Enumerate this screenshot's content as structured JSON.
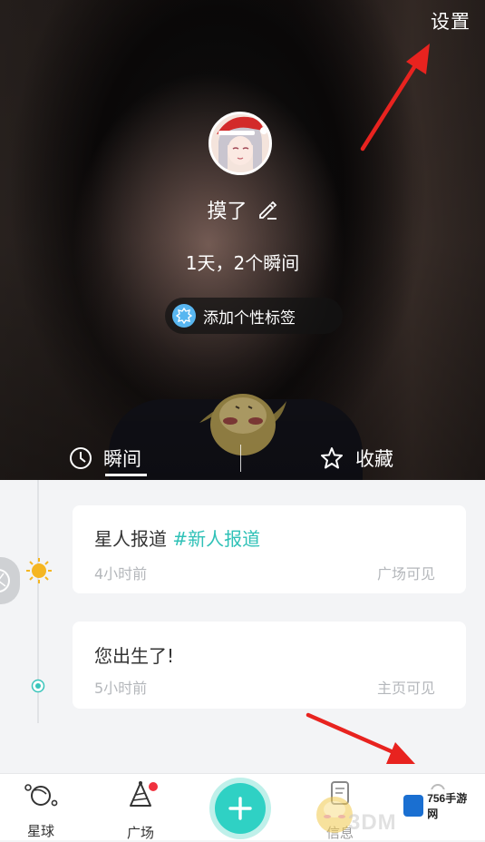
{
  "header": {
    "settings_label": "设置",
    "nickname": "摸了",
    "stats": "1天，2个瞬间",
    "add_tag_label": "添加个性标签"
  },
  "tabs": [
    {
      "label": "瞬间",
      "icon": "clock-icon",
      "active": true
    },
    {
      "label": "收藏",
      "icon": "star-icon",
      "active": false
    }
  ],
  "timeline": [
    {
      "title": "星人报道",
      "topic": "#新人报道",
      "time": "4小时前",
      "visibility": "广场可见",
      "marker": "sun-icon"
    },
    {
      "title": "您出生了!",
      "topic": "",
      "time": "5小时前",
      "visibility": "主页可见",
      "marker": "dot-icon"
    }
  ],
  "bottom_nav": [
    {
      "label": "星球",
      "icon": "planet-icon"
    },
    {
      "label": "广场",
      "icon": "party-hat-icon",
      "has_badge": true
    },
    {
      "label": "",
      "icon": "plus-icon"
    },
    {
      "label": "信息",
      "icon": "message-icon"
    },
    {
      "label": "",
      "icon": "me-icon"
    }
  ],
  "watermarks": {
    "site_logo_text": "756手游网",
    "site_mark": "3DM"
  },
  "colors": {
    "accent": "#2fd1c4",
    "topic": "#2fc1b7",
    "badge": "#f0313e",
    "arrow": "#e8231f"
  }
}
